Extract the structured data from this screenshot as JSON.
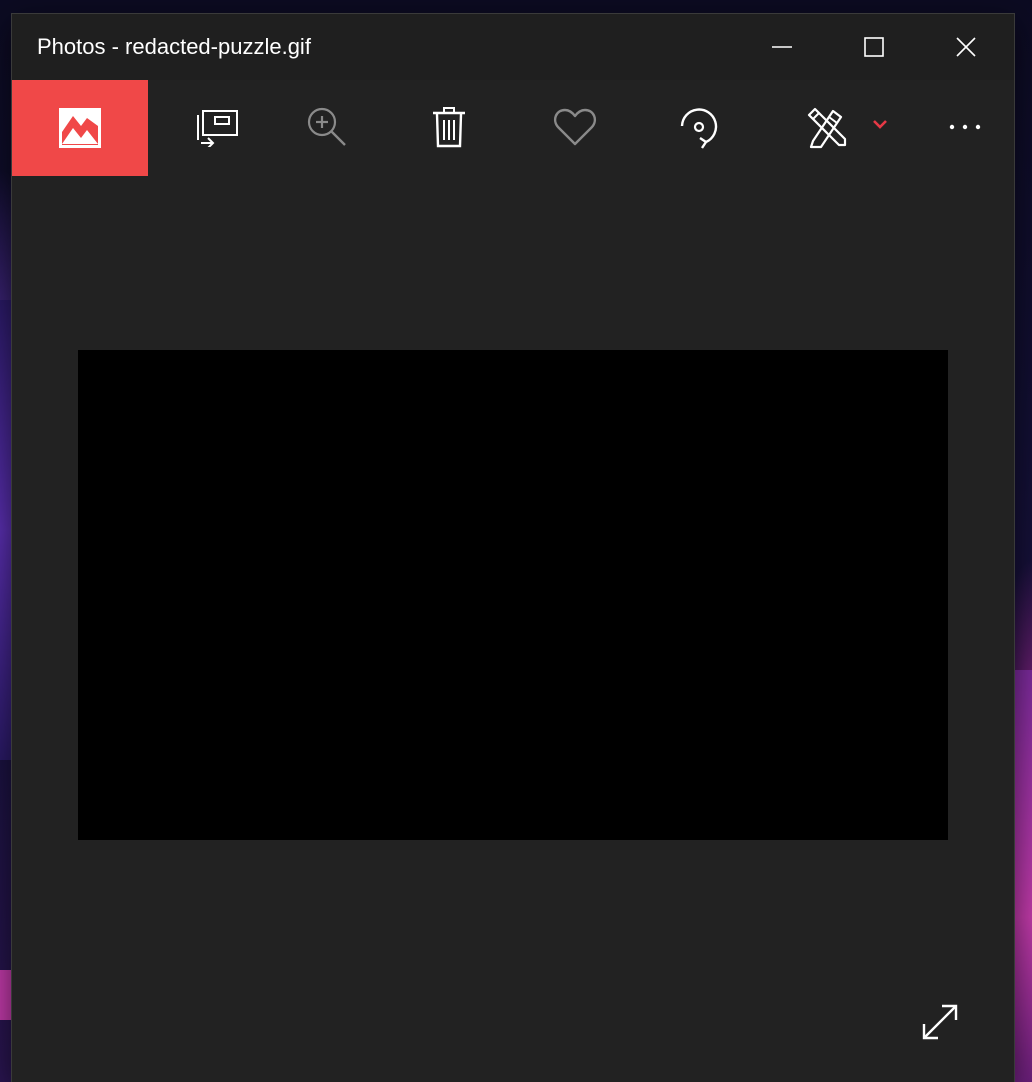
{
  "window": {
    "title": "Photos - redacted-puzzle.gif",
    "controls": {
      "minimize": "minimize-icon",
      "maximize": "maximize-icon",
      "close": "close-icon"
    }
  },
  "toolbar": {
    "items": [
      {
        "name": "see-all-photos",
        "icon": "image-icon",
        "active": true
      },
      {
        "name": "slideshow",
        "icon": "slideshow-icon",
        "active": false
      },
      {
        "name": "zoom",
        "icon": "zoom-in-icon",
        "active": false,
        "disabled": true
      },
      {
        "name": "delete",
        "icon": "trash-icon",
        "active": false
      },
      {
        "name": "favorite",
        "icon": "heart-icon",
        "active": false,
        "disabled": true
      },
      {
        "name": "rotate",
        "icon": "rotate-icon",
        "active": false
      },
      {
        "name": "edit-create",
        "icon": "edit-pencil-icon",
        "dropdown_icon": "chevron-down-icon",
        "active": false
      },
      {
        "name": "see-more",
        "icon": "more-ellipsis-icon",
        "active": false
      }
    ]
  },
  "viewer": {
    "image_content": "redacted",
    "fullscreen_icon": "expand-diagonal-icon"
  },
  "colors": {
    "accent": "#f04848",
    "window_bg": "#222222",
    "titlebar_bg": "#1f1f1f",
    "image_bg": "#000000",
    "icon": "#ffffff",
    "icon_disabled": "#8a8a8a",
    "dropdown_chevron": "#e63946"
  }
}
